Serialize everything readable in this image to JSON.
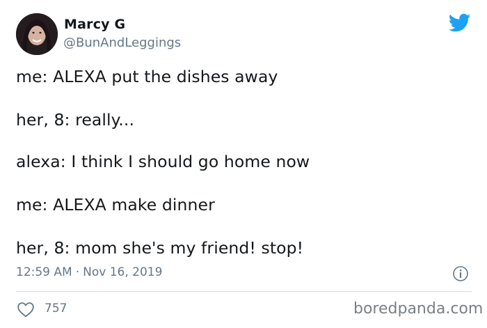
{
  "author": {
    "display_name": "Marcy G",
    "handle": "@BunAndLeggings"
  },
  "tweet": {
    "lines": [
      "me: ALEXA put the dishes away",
      "her, 8: really...",
      "alexa: I think I should go home now",
      "me: ALEXA make dinner",
      "her, 8: mom she's my friend! stop!"
    ],
    "time": "12:59 AM",
    "separator": "·",
    "date": "Nov 16, 2019",
    "likes": "757"
  },
  "watermark": "boredpanda.com",
  "icons": {
    "brand": "twitter-bird-icon",
    "info": "info-icon",
    "like": "heart-icon"
  },
  "colors": {
    "twitter_blue": "#1da1f2",
    "secondary_text": "#657786",
    "primary_text": "#14171a"
  }
}
